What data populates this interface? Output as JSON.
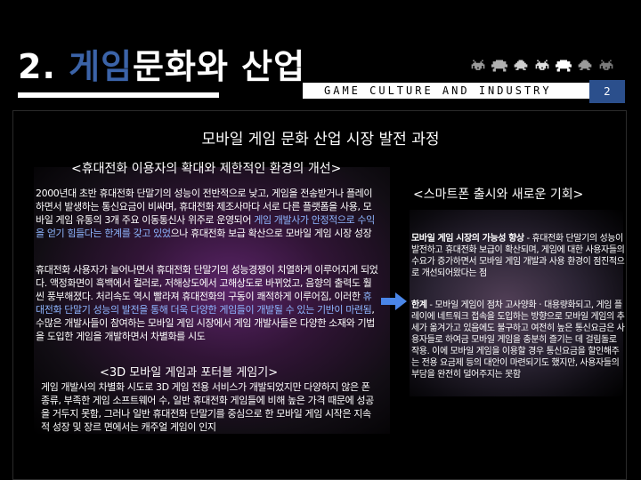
{
  "header": {
    "title_number": "2.",
    "title_highlight": "게임",
    "title_rest": "문화와 산업",
    "banner_text": "GAME CULTURE AND INDUSTRY",
    "page_number": "2"
  },
  "colors": {
    "accent": "#3b63a8",
    "page_badge": "#2b4f8c",
    "link_text": "#8fb6ff"
  },
  "content": {
    "main_heading": "모바일 게임 문화 산업 시장 발전 과정",
    "left_subheading": "<휴대전화 이용자의 확대와 제한적인 환경의 개선>",
    "para1_a": "2000년대 초반 휴대전화 단말기의 성능이 전반적으로 낮고, 게임을 전송받거나 플레이하면서 발생하는 통신요금이 비싸며, 휴대전화 제조사마다 서로 다른 플랫폼을 사용, 모바일 게임 유통의 3개 주요 이동통신사 위주로 운영되어 ",
    "para1_accent": "게임 개발사가 안정적으로 수익을 얻기 힘들다는 한계를 갖고 있었",
    "para1_b": "으나 휴대전화 보급 확산으로 모바일 게임 시장 성장",
    "para2_a": "휴대전화 사용자가 늘어나면서 휴대전화 단말기의 성능경쟁이 치열하게 이루어지게 되었다. 액정화면이 흑백에서 컬러로, 저해상도에서 고해상도로 바뀌었고, 음향의 출력도 훨씬 풍부해졌다. 처리속도 역시 빨라져 휴대전화의 구동이 쾌적하게 이루어짐, 이러한 ",
    "para2_accent": "휴대전화 단말기 성능의 발전을 통해 더욱 다양한 게임들이 개발될 수 있는 기반이 마련됨",
    "para2_b": ", 수많은 개발사들이 참여하는 모바일 게임 시장에서 게임 개발사들은 다양한 소재와 기법을 도입한 게임을 개발하면서 차별화를 시도",
    "sub_heading_3d": "<3D 모바일 게임과 포터블 게임기>",
    "para3": "게임 개발사의 차별화 시도로 3D 게임 전용 서비스가 개발되었지만 다양하지 않은 폰 종류, 부족한 게임 소프트웨어 수, 일반 휴대전화 게임들에 비해 높은 가격 때문에 성공을 거두지 못함, 그러나 일반 휴대전화 단말기를 중심으로 한 모바일 게임 시작은 지속적 성장 및 장르 면에서는 캐주얼 게임이 인지",
    "right_heading": "<스마트폰 출시와 새로운 기회>",
    "right_para1_bold": "모바일 게임 시장의 가능성 향상",
    "right_para1": " - 휴대전화 단말기의 성능이 발전하고 휴대전화 보급이 확산되며, 게임에 대한 사용자들의 수요가 증가하면서 모바일 게임 개발과 사용 환경이 점진적으로 개선되어왔다는 점",
    "right_para2_bold": "한계",
    "right_para2": " - 모바일 게임이 점차 고사양화ㆍ대용량화되고, 게임 플레이에 네트워크 접속을 도입하는 방향으로 모바일 게임의 추세가 옮겨가고 있음에도 불구하고 여전히 높은 통신요금은 사용자들로 하여금 모바일 게임을 충분히 즐기는 데 걸림돌로 작용. 이에 모바일 게임을 이용할 경우 통신요금을 할인해주는 전용 요금제 등의 대안이 마련되기도 했지만, 사용자들의 부담을 완전히 덜어주지는 못함"
  },
  "icons": {
    "invaders": [
      "space-invader-icon",
      "space-invader-icon",
      "space-invader-icon",
      "space-invader-icon",
      "space-invader-icon",
      "space-invader-icon",
      "space-invader-icon"
    ],
    "arrow": "arrow-right-icon"
  }
}
